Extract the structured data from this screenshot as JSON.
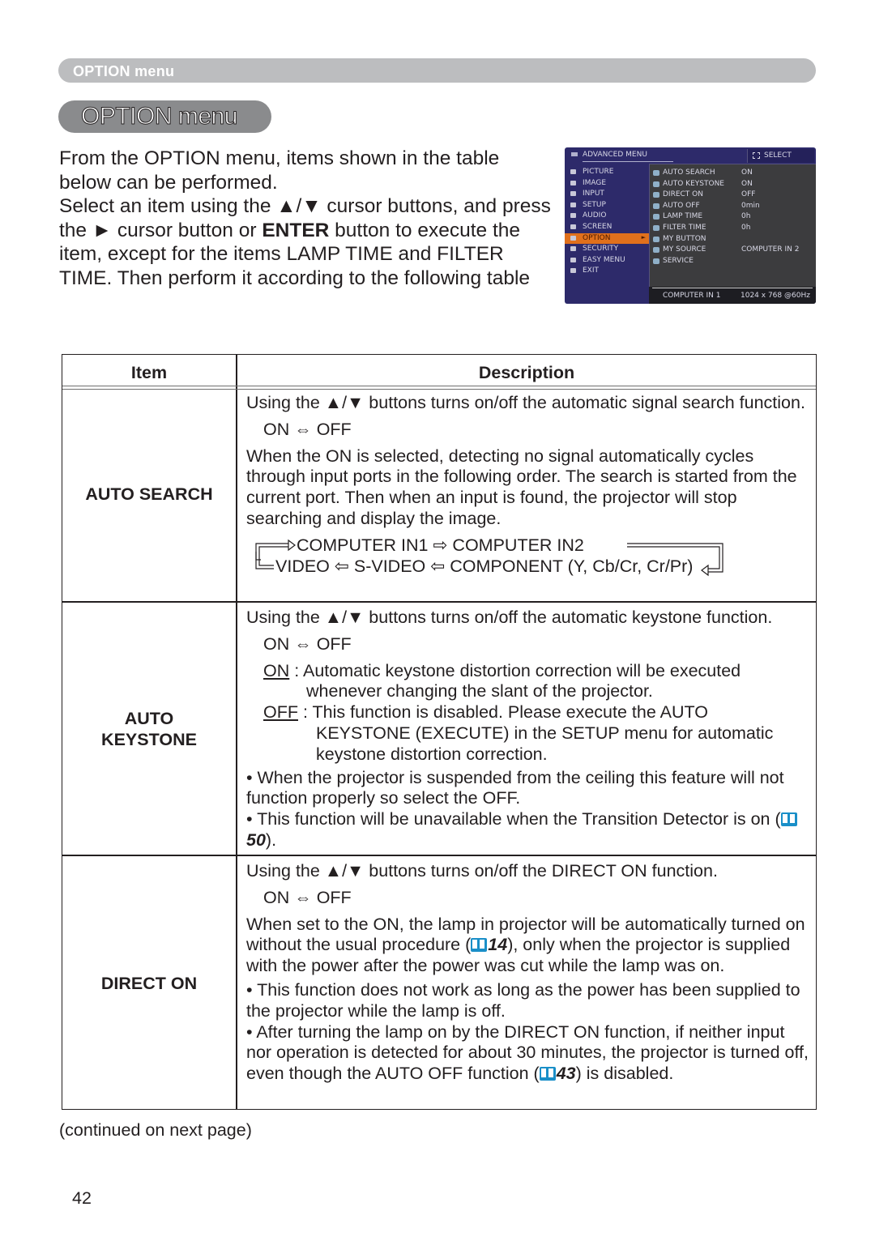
{
  "header": {
    "section_label": "OPTION menu",
    "title": "OPTION menu"
  },
  "intro": {
    "line1": "From the OPTION menu, items shown in the table below can be performed.",
    "line2_before": "Select an item using the ▲/▼ cursor buttons, and press the ► cursor button or ",
    "line2_bold": "ENTER",
    "line2_after": " button to execute the item, except for the items LAMP TIME and FILTER TIME. Then perform it according to the following table"
  },
  "osd_menu": {
    "title": "ADVANCED MENU",
    "select_label": "SELECT",
    "left_items": [
      {
        "label": "PICTURE",
        "icon": "picture-icon"
      },
      {
        "label": "IMAGE",
        "icon": "image-icon"
      },
      {
        "label": "INPUT",
        "icon": "input-icon"
      },
      {
        "label": "SETUP",
        "icon": "setup-icon"
      },
      {
        "label": "AUDIO",
        "icon": "audio-icon"
      },
      {
        "label": "SCREEN",
        "icon": "screen-icon"
      },
      {
        "label": "OPTION",
        "icon": "option-icon",
        "selected": true
      },
      {
        "label": "SECURITY",
        "icon": "security-icon"
      },
      {
        "label": "EASY MENU",
        "icon": "easy-menu-icon"
      },
      {
        "label": "EXIT",
        "icon": "exit-icon"
      }
    ],
    "right_items": [
      {
        "label": "AUTO SEARCH",
        "value": "ON"
      },
      {
        "label": "AUTO KEYSTONE",
        "value": "ON"
      },
      {
        "label": "DIRECT ON",
        "value": "OFF"
      },
      {
        "label": "AUTO OFF",
        "value": "0min"
      },
      {
        "label": "LAMP TIME",
        "value": "0h"
      },
      {
        "label": "FILTER TIME",
        "value": "0h"
      },
      {
        "label": "MY BUTTON",
        "value": ""
      },
      {
        "label": "MY SOURCE",
        "value": "COMPUTER IN 2"
      },
      {
        "label": "SERVICE",
        "value": ""
      }
    ],
    "status_source": "COMPUTER IN 1",
    "status_resolution": "1024 x 768 @60Hz",
    "colors": {
      "background": "#2d2a6a",
      "selected": "#e0701c",
      "panel": "#3c3c3e"
    }
  },
  "table": {
    "headers": {
      "item": "Item",
      "description": "Description"
    },
    "rows": [
      {
        "item": "AUTO SEARCH",
        "desc": {
          "p1": "Using the ▲/▼ buttons turns on/off the automatic signal search function.",
          "toggle": "ON ⇔ OFF",
          "p2": "When the ON is selected, detecting no signal automatically cycles through input ports in the following order. The search is started from the current port. Then when an input is found, the projector will stop searching and display the image.",
          "flow_line1": "COMPUTER IN1  ⇨  COMPUTER IN2",
          "flow_line2": "VIDEO ⇦ S-VIDEO ⇦ COMPONENT (Y, Cb/Cr, Cr/Pr)"
        }
      },
      {
        "item_line1": "AUTO",
        "item_line2": "KEYSTONE",
        "desc": {
          "p1": "Using the ▲/▼ buttons turns on/off the automatic keystone function.",
          "toggle": "ON ⇔ OFF",
          "on_key": "ON",
          "on_text_1": " : Automatic keystone distortion correction will be executed",
          "on_text_2": "whenever changing the slant of the projector.",
          "off_key": "OFF",
          "off_text_1": " : This function is disabled. Please execute the AUTO",
          "off_text_2": "KEYSTONE (EXECUTE) in the SETUP menu for automatic",
          "off_text_3": "keystone distortion correction.",
          "note1": "• When the projector is suspended from the ceiling this feature will not function properly so select the OFF.",
          "note2_before": "• This function will be unavailable when the Transition Detector is on (",
          "note2_ref": "50",
          "note2_after": ")."
        }
      },
      {
        "item": "DIRECT ON",
        "desc": {
          "p1": "Using the ▲/▼ buttons turns on/off the DIRECT ON function.",
          "toggle": "ON ⇔ OFF",
          "p2_before": "When set to the ON, the lamp in projector will be automatically turned on without the usual procedure (",
          "p2_ref": "14",
          "p2_after": "), only when the projector is supplied with the power after the power was cut while the lamp was on.",
          "note1": "• This function does not work as long as the power has been supplied to the projector while the lamp is off.",
          "note2_before": "• After turning the lamp on by the DIRECT ON function, if neither input nor operation is detected for about 30 minutes, the projector is turned off, even though the AUTO OFF function (",
          "note2_ref": "43",
          "note2_after": ") is disabled."
        }
      }
    ]
  },
  "footer": {
    "continued": "(continued on next page)",
    "page_number": "42"
  }
}
